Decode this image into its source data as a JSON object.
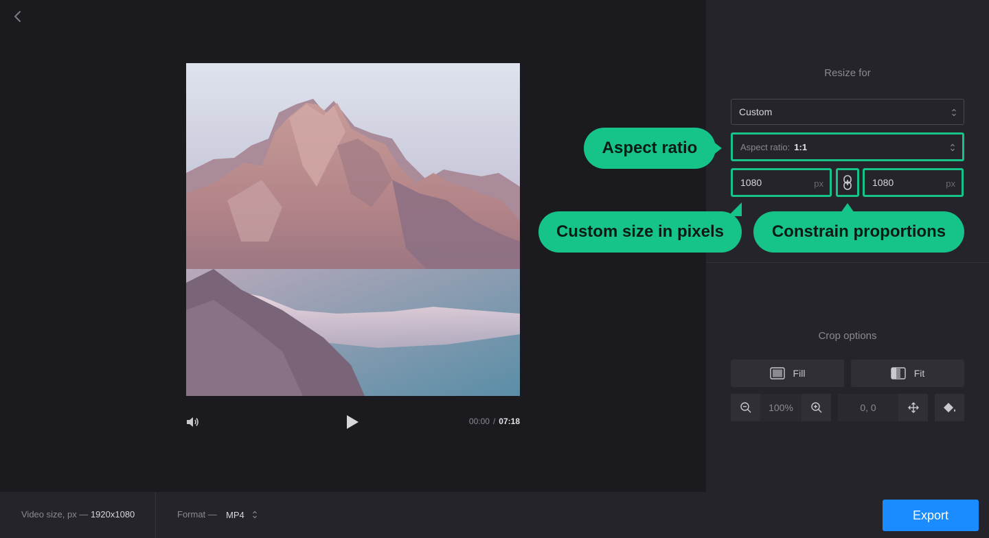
{
  "resize": {
    "title": "Resize for",
    "preset": "Custom",
    "aspect_ratio_label": "Aspect ratio:",
    "aspect_ratio_value": "1:1",
    "width": "1080",
    "height": "1080",
    "unit": "px"
  },
  "callouts": {
    "aspect_ratio": "Aspect ratio",
    "custom_size": "Custom size in pixels",
    "constrain": "Constrain proportions"
  },
  "crop": {
    "title": "Crop options",
    "fill_label": "Fill",
    "fit_label": "Fit",
    "zoom": "100%",
    "position": "0, 0"
  },
  "player": {
    "current_time": "00:00",
    "separator": "/",
    "duration": "07:18"
  },
  "footer": {
    "video_size_label": "Video size, px —",
    "video_size_value": "1920x1080",
    "format_label": "Format —",
    "format_value": "MP4",
    "export_label": "Export"
  },
  "colors": {
    "accent": "#16c48a",
    "export": "#1a8cff",
    "background": "#1b1a1f",
    "panel": "#25242a"
  },
  "icons": [
    "back-arrow-icon",
    "volume-icon",
    "play-icon",
    "link-icon",
    "fill-icon",
    "fit-icon",
    "zoom-out-icon",
    "zoom-in-icon",
    "move-icon",
    "paint-bucket-icon",
    "select-arrows-icon"
  ]
}
